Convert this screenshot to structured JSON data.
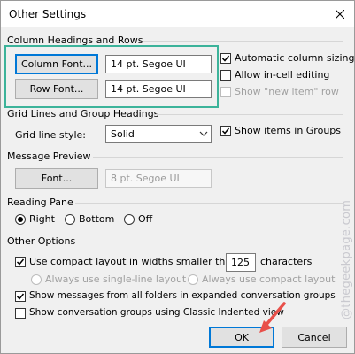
{
  "title": "Other Settings",
  "sections": {
    "column_headings": "Column Headings and Rows",
    "grid_lines": "Grid Lines and Group Headings",
    "message_preview": "Message Preview",
    "reading_pane": "Reading Pane",
    "other_options": "Other Options"
  },
  "column_font_button": "Column Font...",
  "column_font_value": "14 pt. Segoe UI",
  "row_font_button": "Row Font...",
  "row_font_value": "14 pt. Segoe UI",
  "auto_column_sizing": {
    "label": "Automatic column sizing",
    "checked": true
  },
  "allow_in_cell_editing": {
    "label": "Allow in-cell editing",
    "checked": false
  },
  "show_new_item_row": {
    "label": "Show \"new item\" row",
    "checked": false,
    "enabled": false
  },
  "grid_line_style": {
    "label": "Grid line style:",
    "value": "Solid"
  },
  "show_items_in_groups": {
    "label": "Show items in Groups",
    "checked": true
  },
  "preview_font_button": "Font...",
  "preview_font_value": "8 pt. Segoe UI",
  "reading_pane": {
    "options": [
      "Right",
      "Bottom",
      "Off"
    ],
    "selected": "Right"
  },
  "compact_layout": {
    "label_before": "Use compact layout in widths smaller than",
    "value": "125",
    "label_after": "characters",
    "checked": true
  },
  "single_line_layout": {
    "label": "Always use single-line layout",
    "selected": false,
    "enabled": false
  },
  "always_compact_layout": {
    "label": "Always use compact layout",
    "selected": false,
    "enabled": false
  },
  "show_messages_all_folders": {
    "label": "Show messages from all folders in expanded conversation groups",
    "checked": true
  },
  "classic_indented_view": {
    "label": "Show conversation groups using Classic Indented view",
    "checked": false
  },
  "ok_button": "OK",
  "cancel_button": "Cancel",
  "watermark": "@thegeekpage.com",
  "colors": {
    "highlight": "#3cb39a",
    "arrow": "#e8504a",
    "default_button_border": "#0078d7"
  }
}
